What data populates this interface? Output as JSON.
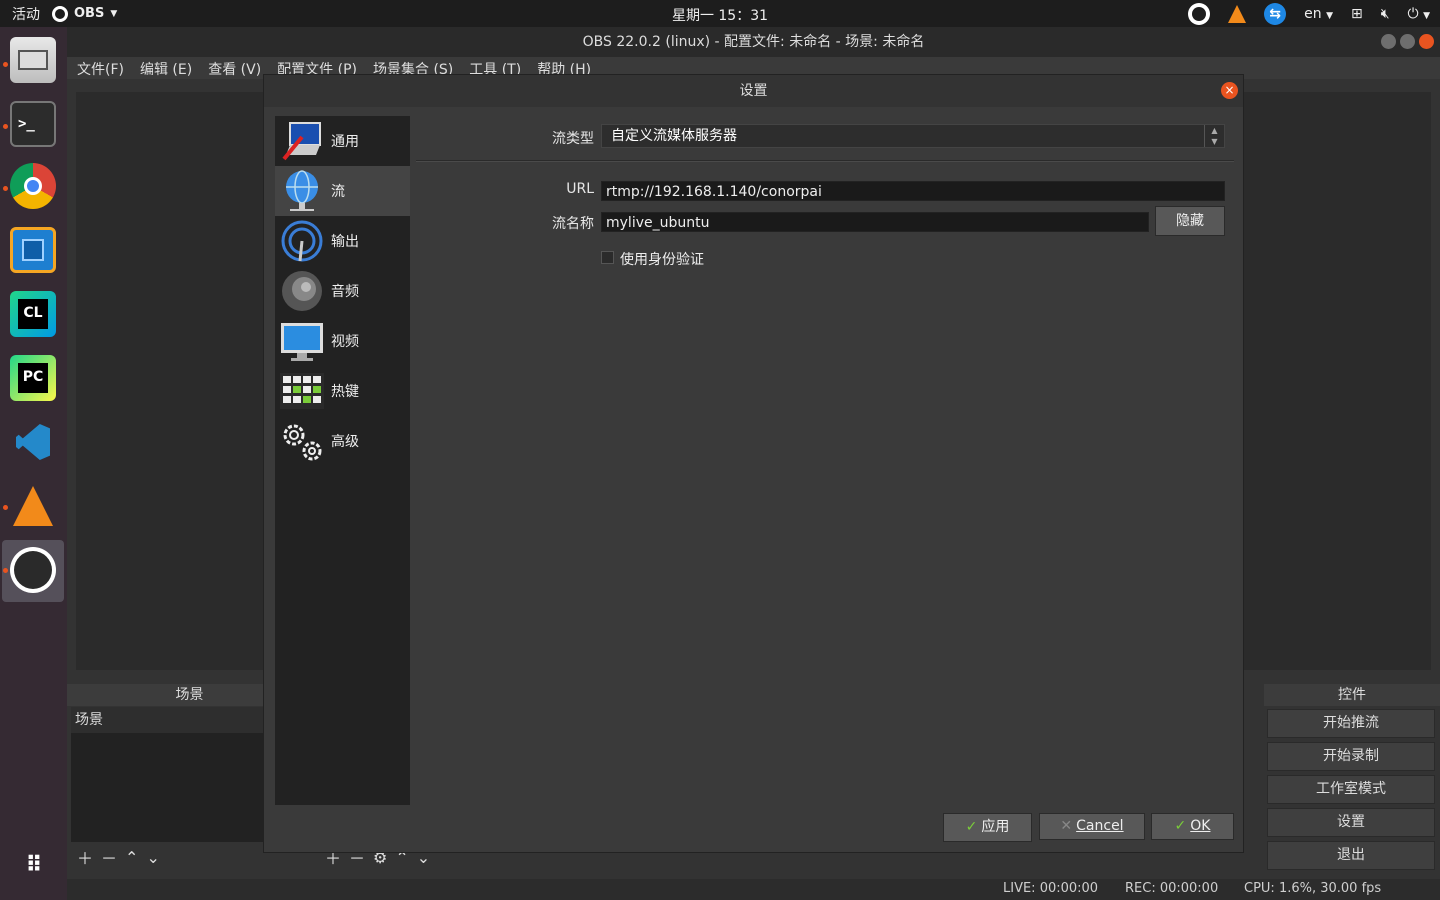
{
  "topbar": {
    "activities": "活动",
    "app_name": "OBS",
    "clock": "星期一 15：31",
    "input_method": "en"
  },
  "window": {
    "title": "OBS 22.0.2 (linux) - 配置文件: 未命名 - 场景: 未命名"
  },
  "menubar": {
    "items": [
      "文件(F)",
      "编辑 (E)",
      "查看 (V)",
      "配置文件 (P)",
      "场景集合 (S)",
      "工具 (T)",
      "帮助 (H)"
    ]
  },
  "dock": {
    "items": [
      "files-icon",
      "terminal-icon",
      "chrome-icon",
      "virtualbox-icon",
      "clion-icon",
      "pycharm-icon",
      "vscode-icon",
      "vlc-icon",
      "obs-icon"
    ],
    "clion_label": "CL",
    "pycharm_label": "PC"
  },
  "panels": {
    "scenes_title": "场景",
    "scene_item": "场景",
    "controls_title": "控件"
  },
  "controls": {
    "start_streaming": "开始推流",
    "start_recording": "开始录制",
    "studio_mode": "工作室模式",
    "settings": "设置",
    "exit": "退出"
  },
  "statusbar": {
    "live": "LIVE: 00:00:00",
    "rec": "REC: 00:00:00",
    "cpu": "CPU: 1.6%, 30.00 fps"
  },
  "dialog": {
    "title": "设置",
    "categories": [
      {
        "label": "通用",
        "icon": "general-icon"
      },
      {
        "label": "流",
        "icon": "stream-globe-icon"
      },
      {
        "label": "输出",
        "icon": "output-icon"
      },
      {
        "label": "音频",
        "icon": "audio-speaker-icon"
      },
      {
        "label": "视频",
        "icon": "video-monitor-icon"
      },
      {
        "label": "热键",
        "icon": "hotkeys-keyboard-icon"
      },
      {
        "label": "高级",
        "icon": "advanced-gears-icon"
      }
    ],
    "active_category": "流",
    "stream_type_label": "流类型",
    "stream_type_value": "自定义流媒体服务器",
    "url_label": "URL",
    "url_value": "rtmp://192.168.1.140/conorpai",
    "key_label": "流名称",
    "key_value": "mylive_ubuntu",
    "hide_button": "隐藏",
    "auth_checkbox_label": "使用身份验证",
    "auth_checked": false,
    "apply_button": "应用",
    "cancel_button": "Cancel",
    "ok_button": "OK"
  },
  "colors": {
    "accent": "#e95420",
    "check_green": "#7acc3a",
    "dock_bg": "#352a33"
  }
}
